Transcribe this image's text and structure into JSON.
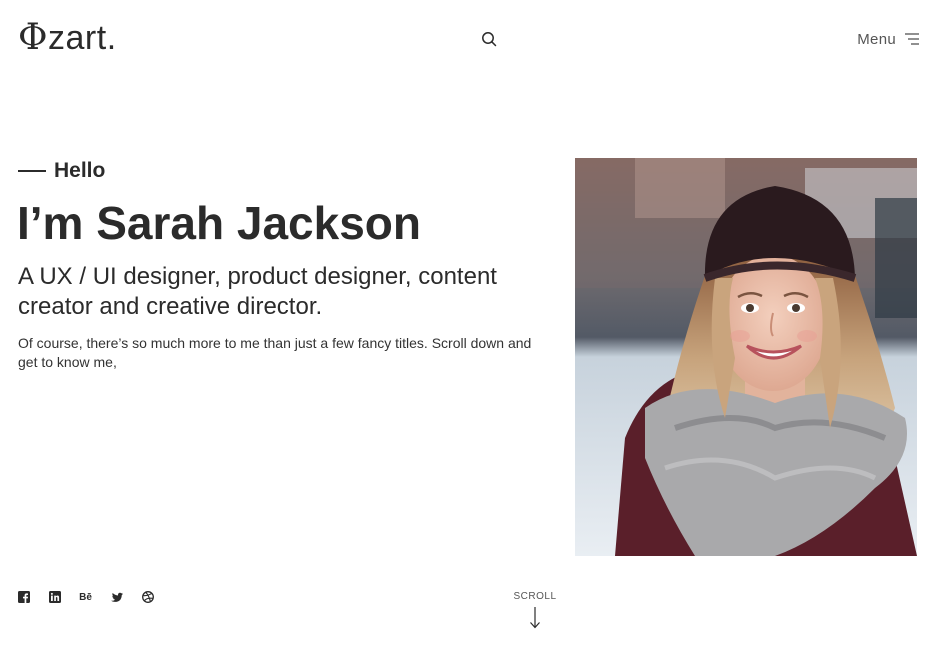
{
  "header": {
    "logo_mark": "Φ",
    "logo_text": "zart",
    "logo_dot": ".",
    "search_icon": "search-icon",
    "menu_label": "Menu",
    "menu_icon": "hamburger-icon"
  },
  "hero": {
    "hello": "Hello",
    "greeting_prefix": "I’m ",
    "name": "Sarah Jackson",
    "subtitle": "A UX / UI designer, product designer, content creator and creative director.",
    "intro": "Of course, there’s so much more to me than just a few fancy titles. Scroll down and get to know me,"
  },
  "socials": [
    {
      "icon": "facebook-icon"
    },
    {
      "icon": "linkedin-icon"
    },
    {
      "icon": "behance-icon",
      "glyph": "Bē"
    },
    {
      "icon": "twitter-icon"
    },
    {
      "icon": "dribbble-icon"
    }
  ],
  "scroll": {
    "label": "SCROLL",
    "icon": "arrow-down-icon"
  },
  "colors": {
    "text": "#2b2b2b",
    "background": "#ffffff"
  }
}
